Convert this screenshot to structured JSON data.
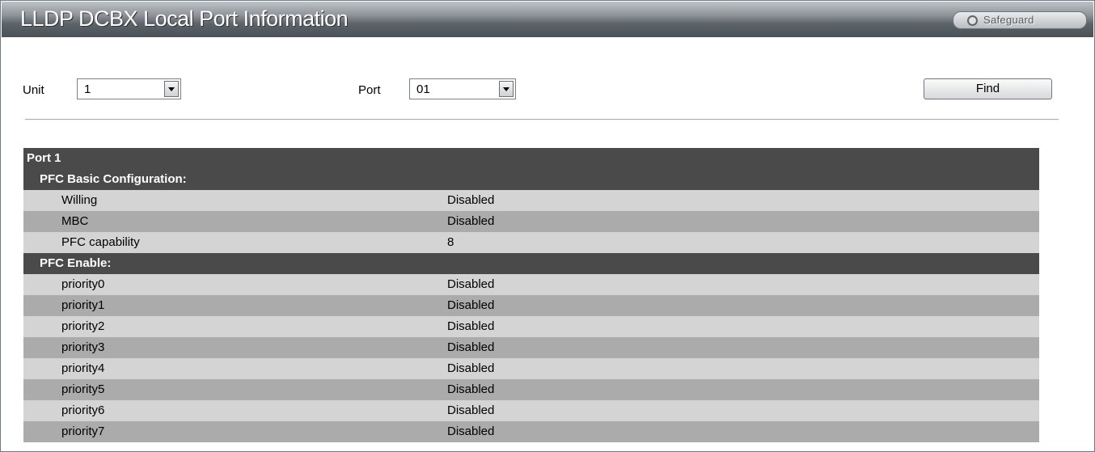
{
  "window": {
    "title": "LLDP DCBX Local Port Information",
    "safeguard_label": "Safeguard"
  },
  "filters": {
    "unit_label": "Unit",
    "unit_value": "1",
    "port_label": "Port",
    "port_value": "01",
    "find_label": "Find"
  },
  "port_info": {
    "port_header": "Port 1",
    "pfc_basic_header": "PFC Basic Configuration:",
    "pfc_basic": [
      {
        "label": "Willing",
        "value": "Disabled"
      },
      {
        "label": "MBC",
        "value": "Disabled"
      },
      {
        "label": "PFC capability",
        "value": "8"
      }
    ],
    "pfc_enable_header": "PFC Enable:",
    "pfc_enable": [
      {
        "label": "priority0",
        "value": "Disabled"
      },
      {
        "label": "priority1",
        "value": "Disabled"
      },
      {
        "label": "priority2",
        "value": "Disabled"
      },
      {
        "label": "priority3",
        "value": "Disabled"
      },
      {
        "label": "priority4",
        "value": "Disabled"
      },
      {
        "label": "priority5",
        "value": "Disabled"
      },
      {
        "label": "priority6",
        "value": "Disabled"
      },
      {
        "label": "priority7",
        "value": "Disabled"
      }
    ]
  }
}
